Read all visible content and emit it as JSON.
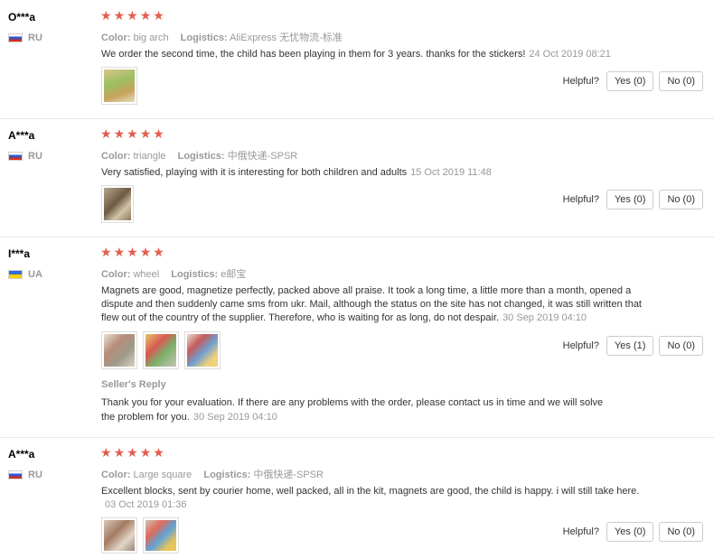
{
  "reviews": [
    {
      "user": "O***a",
      "country": "RU",
      "flag": "ru",
      "color_label": "Color:",
      "color_value": "big arch",
      "logistics_label": "Logistics:",
      "logistics_value": "AliExpress 无忧物流-标准",
      "text": "We order the second time, the child has been playing in them for 3 years. thanks for the stickers!",
      "date": "24 Oct 2019 08:21",
      "helpful_label": "Helpful?",
      "yes": "Yes (0)",
      "no": "No (0)"
    },
    {
      "user": "A***a",
      "country": "RU",
      "flag": "ru",
      "color_label": "Color:",
      "color_value": "triangle",
      "logistics_label": "Logistics:",
      "logistics_value": "中俄快递-SPSR",
      "text": "Very satisfied, playing with it is interesting for both children and adults",
      "date": "15 Oct 2019 11:48",
      "helpful_label": "Helpful?",
      "yes": "Yes (0)",
      "no": "No (0)"
    },
    {
      "user": "I***a",
      "country": "UA",
      "flag": "ua",
      "color_label": "Color:",
      "color_value": "wheel",
      "logistics_label": "Logistics:",
      "logistics_value": "e邮宝",
      "text": "Magnets are good, magnetize perfectly, packed above all praise. It took a long time, a little more than a month, opened a dispute and then suddenly came sms from ukr. Mail, although the status on the site has not changed, it was still written that flew out of the country of the supplier. Therefore, who is waiting for as long, do not despair.",
      "date": "30 Sep 2019 04:10",
      "helpful_label": "Helpful?",
      "yes": "Yes (1)",
      "no": "No (0)",
      "seller_reply_title": "Seller's Reply",
      "seller_reply_text": "Thank you for your evaluation. If there are any problems with the order, please contact us in time and we will solve the problem for you.",
      "seller_reply_date": "30 Sep 2019 04:10"
    },
    {
      "user": "A***a",
      "country": "RU",
      "flag": "ru",
      "color_label": "Color:",
      "color_value": "Large square",
      "logistics_label": "Logistics:",
      "logistics_value": "中俄快递-SPSR",
      "text": "Excellent blocks, sent by courier home, well packed, all in the kit, magnets are good, the child is happy. i will still take here.",
      "date": "03 Oct 2019 01:36",
      "helpful_label": "Helpful?",
      "yes": "Yes (0)",
      "no": "No (0)"
    }
  ],
  "star_icon": "star-icon",
  "star_color": "#e35d4f"
}
